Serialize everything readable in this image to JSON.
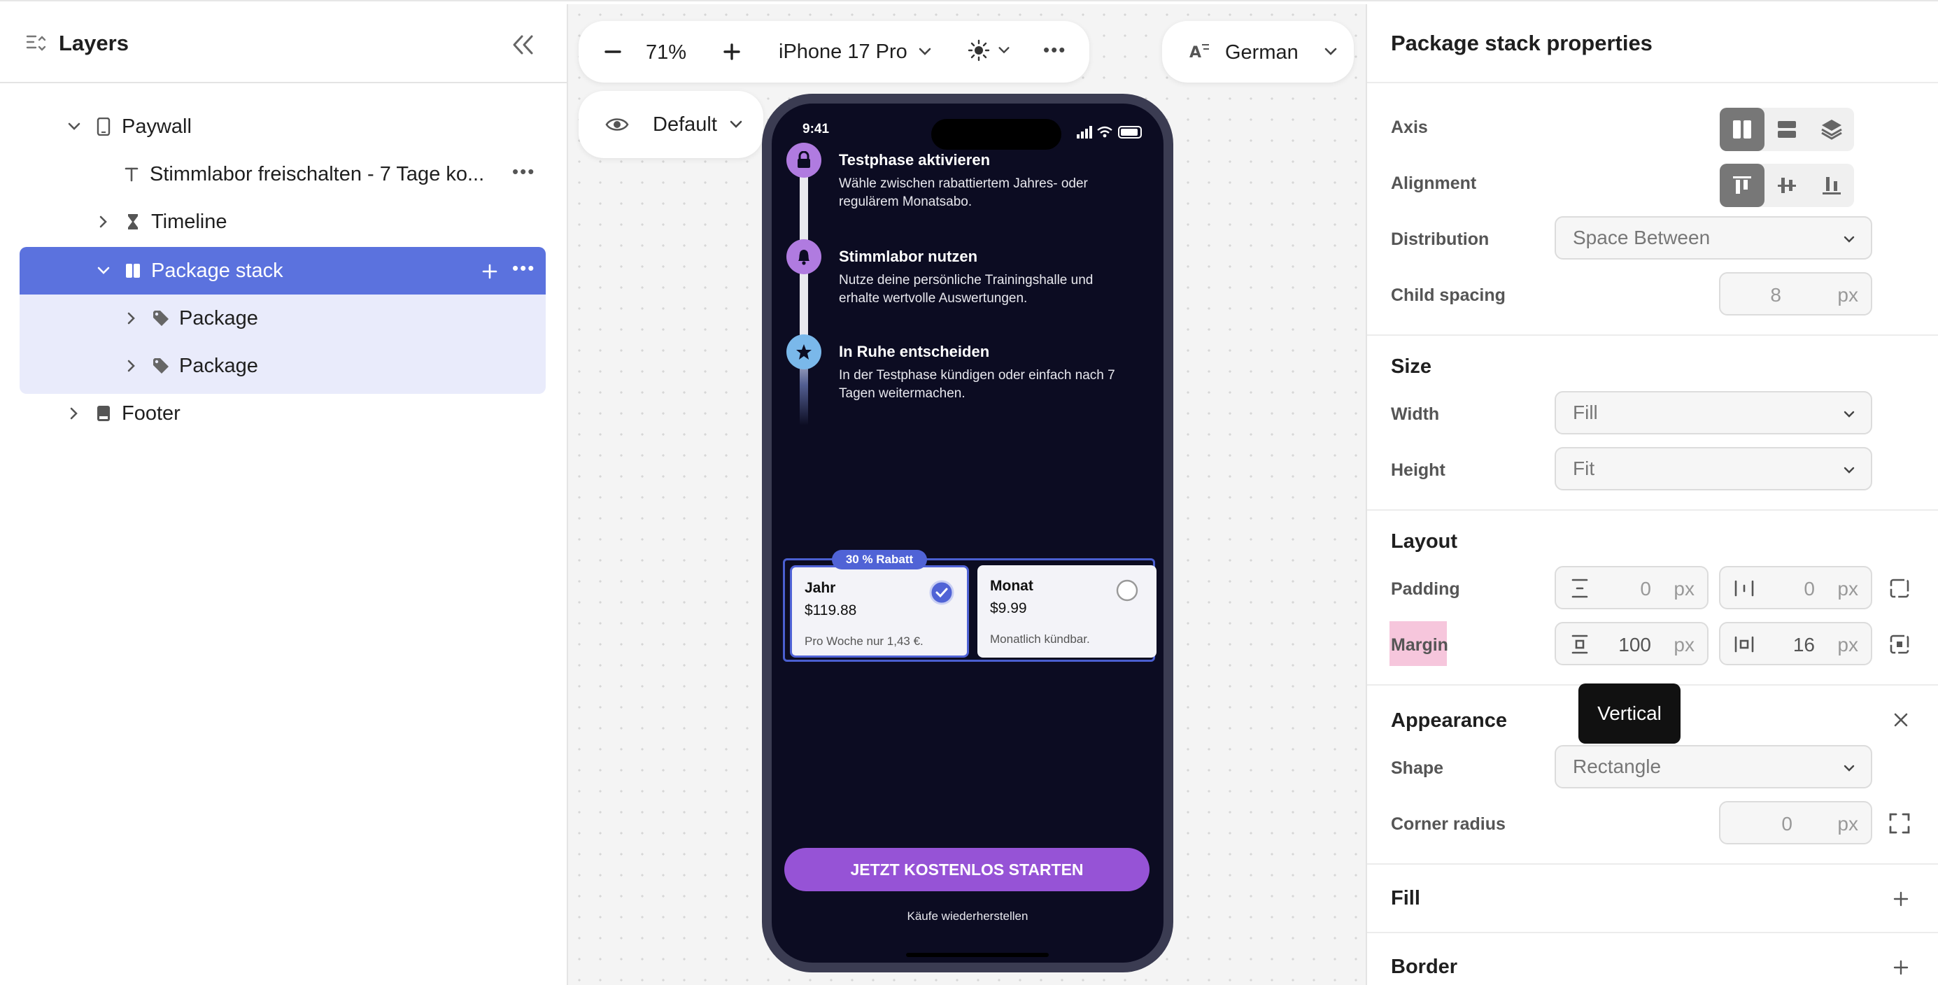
{
  "layers": {
    "title": "Layers",
    "items": [
      {
        "label": "Paywall"
      },
      {
        "label": "Stimmlabor freischalten  - 7 Tage ko..."
      },
      {
        "label": "Timeline"
      },
      {
        "label": "Package stack"
      },
      {
        "label": "Package"
      },
      {
        "label": "Package"
      },
      {
        "label": "Footer"
      }
    ]
  },
  "toolbar": {
    "zoom": "71%",
    "device": "iPhone 17 Pro",
    "language": "German",
    "state": "Default"
  },
  "phone": {
    "status_time": "9:41",
    "timeline": [
      {
        "title": "Testphase aktivieren",
        "desc": "Wähle zwischen rabattiertem Jahres- oder regulärem Monatsabo."
      },
      {
        "title": "Stimmlabor nutzen",
        "desc": "Nutze deine persönliche Trainingshalle und erhalte wertvolle Auswertungen."
      },
      {
        "title": "In Ruhe entscheiden",
        "desc": "In der Testphase kündigen oder einfach nach 7 Tagen weitermachen."
      }
    ],
    "badge": "30 % Rabatt",
    "packages": [
      {
        "name": "Jahr",
        "price": "$119.88",
        "desc": "Pro Woche nur 1,43 €."
      },
      {
        "name": "Monat",
        "price": "$9.99",
        "desc": "Monatlich kündbar."
      }
    ],
    "cta": "JETZT KOSTENLOS STARTEN",
    "restore": "Käufe wiederherstellen"
  },
  "props": {
    "title": "Package stack properties",
    "axis_label": "Axis",
    "alignment_label": "Alignment",
    "distribution_label": "Distribution",
    "distribution_value": "Space Between",
    "child_spacing_label": "Child spacing",
    "child_spacing_value": "8",
    "unit": "px",
    "size_title": "Size",
    "width_label": "Width",
    "width_value": "Fill",
    "height_label": "Height",
    "height_value": "Fit",
    "layout_title": "Layout",
    "padding_label": "Padding",
    "padding_v": "0",
    "padding_h": "0",
    "margin_label": "Margin",
    "margin_v": "100",
    "margin_h": "16",
    "appearance_title": "Appearance",
    "shape_label": "Shape",
    "shape_value": "Rectangle",
    "corner_label": "Corner radius",
    "corner_value": "0",
    "fill_title": "Fill",
    "border_title": "Border",
    "tooltip": "Vertical"
  },
  "colors": {
    "selection": "#5b72de",
    "purple": "#9653d6",
    "phone_bg": "#0c0c22"
  }
}
